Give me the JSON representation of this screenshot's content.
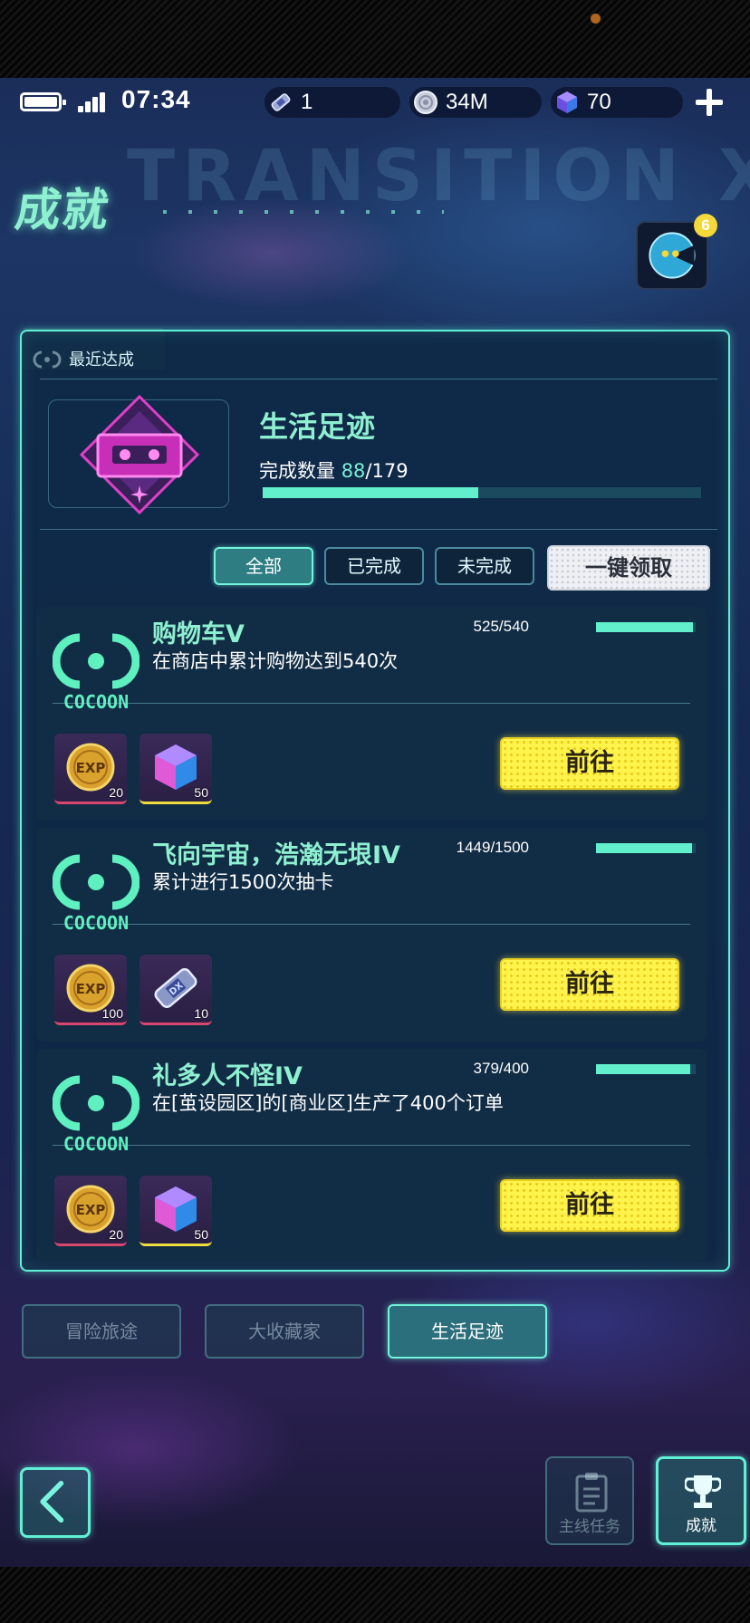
{
  "status_bar": {
    "time": "07:34",
    "resources": [
      {
        "icon": "ticket-icon",
        "value": "1"
      },
      {
        "icon": "coin-disc-icon",
        "value": "34M"
      },
      {
        "icon": "gem-cube-icon",
        "value": "70"
      }
    ]
  },
  "header": {
    "title": "成就",
    "bg_text": "TRANSITION XXX",
    "avatar_badge": "6"
  },
  "featured": {
    "section_label": "最近达成",
    "name": "生活足迹",
    "progress_label": "完成数量",
    "progress_value": "88",
    "progress_total": "/179",
    "progress_fraction": 0.4916
  },
  "filters": {
    "all": "全部",
    "completed": "已完成",
    "incomplete": "未完成",
    "claim_all": "一键领取"
  },
  "achievements": [
    {
      "name": "购物车V",
      "desc": "在商店中累计购物达到540次",
      "count": "525/540",
      "progress": 0.9722,
      "logo_text": "COCOON",
      "rewards": [
        {
          "icon": "exp-coin-icon",
          "qty": "20"
        },
        {
          "icon": "gem-cube-icon",
          "qty": "50"
        }
      ],
      "button": "前往"
    },
    {
      "name": "飞向宇宙，浩瀚无垠IV",
      "desc": "累计进行1500次抽卡",
      "count": "1449/1500",
      "progress": 0.966,
      "logo_text": "COCOON",
      "rewards": [
        {
          "icon": "exp-coin-icon",
          "qty": "100"
        },
        {
          "icon": "ticket-icon",
          "qty": "10"
        }
      ],
      "button": "前往"
    },
    {
      "name": "礼多人不怪IV",
      "desc": "在[茧设园区]的[商业区]生产了400个订单",
      "count": "379/400",
      "progress": 0.9475,
      "logo_text": "COCOON",
      "rewards": [
        {
          "icon": "exp-coin-icon",
          "qty": "20"
        },
        {
          "icon": "gem-cube-icon",
          "qty": "50"
        }
      ],
      "button": "前往"
    }
  ],
  "categories": [
    "冒险旅途",
    "大收藏家",
    "生活足迹"
  ],
  "bottom_nav": {
    "main_quest": "主线任务",
    "achievements": "成就"
  },
  "colors": {
    "accent": "#5ff0d5",
    "title": "#8ef0d0",
    "button_yellow": "#fff34c",
    "panel_bg": "#0e2844"
  }
}
